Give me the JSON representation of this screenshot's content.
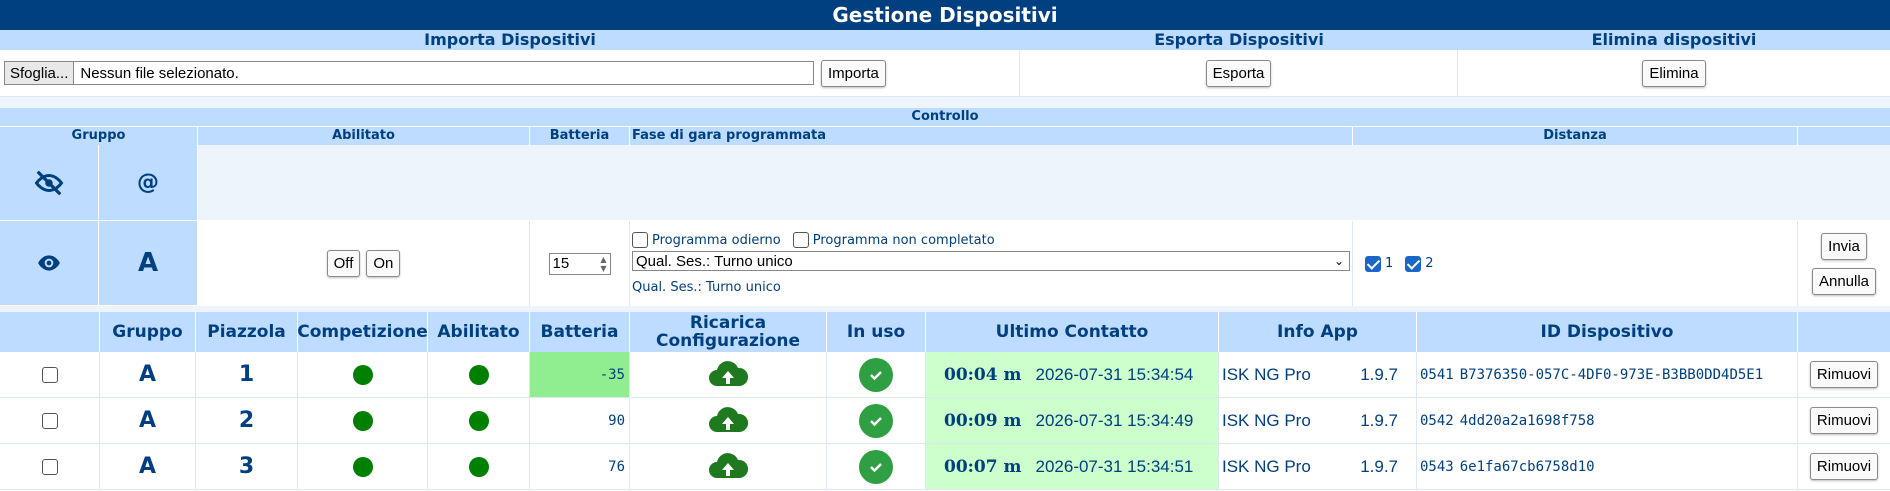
{
  "title": "Gestione Dispositivi",
  "sections": {
    "import": {
      "header": "Importa Dispositivi",
      "browse_label": "Sfoglia...",
      "file_text": "Nessun file selezionato.",
      "button": "Importa"
    },
    "export": {
      "header": "Esporta Dispositivi",
      "button": "Esporta"
    },
    "delete": {
      "header": "Elimina dispositivi",
      "button": "Elimina"
    }
  },
  "control": {
    "header": "Controllo",
    "columns": {
      "gruppo": "Gruppo",
      "abilitato": "Abilitato",
      "batteria": "Batteria",
      "fase": "Fase di gara programmata",
      "distanza": "Distanza"
    },
    "row1": {
      "icon": "eye-off-icon",
      "symbol": "@"
    },
    "row2": {
      "icon": "eye-icon",
      "group": "A",
      "off_label": "Off",
      "on_label": "On",
      "battery_value": "15",
      "chk_today_label": "Programma odierno",
      "chk_incomplete_label": "Programma non completato",
      "selected_phase": "Qual. Ses.: Turno unico",
      "phase_note": "Qual. Ses.: Turno unico",
      "dist1_label": "1",
      "dist2_label": "2",
      "send_label": "Invia",
      "cancel_label": "Annulla"
    }
  },
  "table": {
    "headers": {
      "gruppo": "Gruppo",
      "piazzola": "Piazzola",
      "competizione": "Competizione",
      "abilitato": "Abilitato",
      "batteria": "Batteria",
      "ricarica1": "Ricarica",
      "ricarica2": "Configurazione",
      "in_uso": "In uso",
      "ultimo": "Ultimo Contatto",
      "info": "Info App",
      "id": "ID Dispositivo"
    },
    "remove_label": "Rimuovi",
    "rows": [
      {
        "group": "A",
        "piazzola": "1",
        "battery": "-35",
        "battery_low": true,
        "elapsed": "00:04 m",
        "datetime": "2026-07-31 15:34:54",
        "app": "ISK NG Pro",
        "version": "1.9.7",
        "code": "0541",
        "device_id": "B7376350-057C-4DF0-973E-B3BB0DD4D5E1"
      },
      {
        "group": "A",
        "piazzola": "2",
        "battery": "90",
        "battery_low": false,
        "elapsed": "00:09 m",
        "datetime": "2026-07-31 15:34:49",
        "app": "ISK NG Pro",
        "version": "1.9.7",
        "code": "0542",
        "device_id": "4dd20a2a1698f758"
      },
      {
        "group": "A",
        "piazzola": "3",
        "battery": "76",
        "battery_low": false,
        "elapsed": "00:07 m",
        "datetime": "2026-07-31 15:34:51",
        "app": "ISK NG Pro",
        "version": "1.9.7",
        "code": "0543",
        "device_id": "6e1fa67cb6758d10"
      }
    ]
  },
  "colors": {
    "header_dark": "#003f80",
    "header_light": "#bedcff",
    "status_green": "#008000",
    "battery_low_bg": "#90ee90",
    "contact_bg": "#ccffcc"
  }
}
